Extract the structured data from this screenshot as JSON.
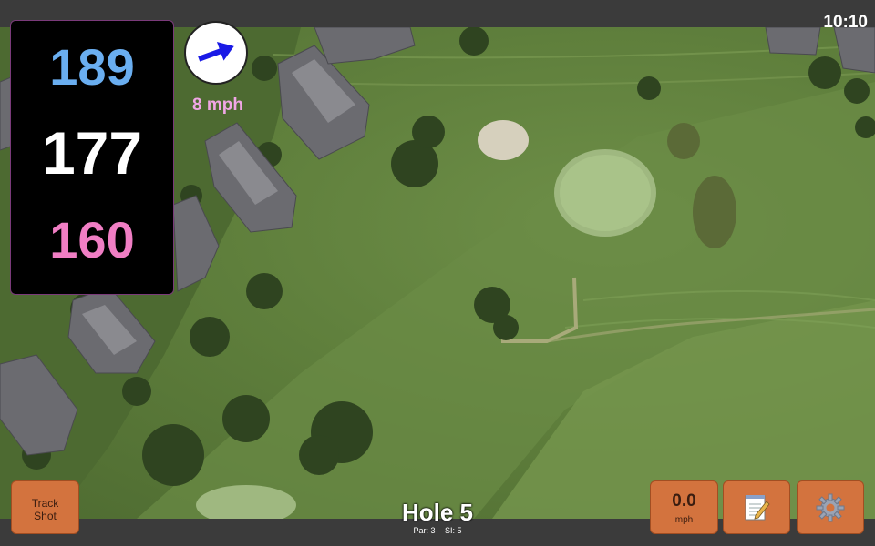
{
  "status": {
    "time": "10:10"
  },
  "distances": {
    "back": "189",
    "center": "177",
    "front": "160",
    "back_color": "#6aaef0",
    "center_color": "#ffffff",
    "front_color": "#f07ec4"
  },
  "wind": {
    "speed_label": "8 mph",
    "speed_color": "#f0a6e6",
    "arrow_color": "#1a1ae6",
    "arrow_icon": "arrow-right-up-icon"
  },
  "hole": {
    "title": "Hole 5",
    "par": "Par: 3",
    "stroke_index": "SI: 5"
  },
  "buttons": {
    "track_shot": [
      "Track",
      "Shot"
    ],
    "wind_value": "0.0",
    "wind_unit": "mph",
    "notes_icon": "notepad-icon",
    "settings_icon": "gear-icon",
    "accent": "#d3733e"
  },
  "map": {
    "view": "aerial satellite view of golf hole with green, bunker, fairway and houses"
  }
}
